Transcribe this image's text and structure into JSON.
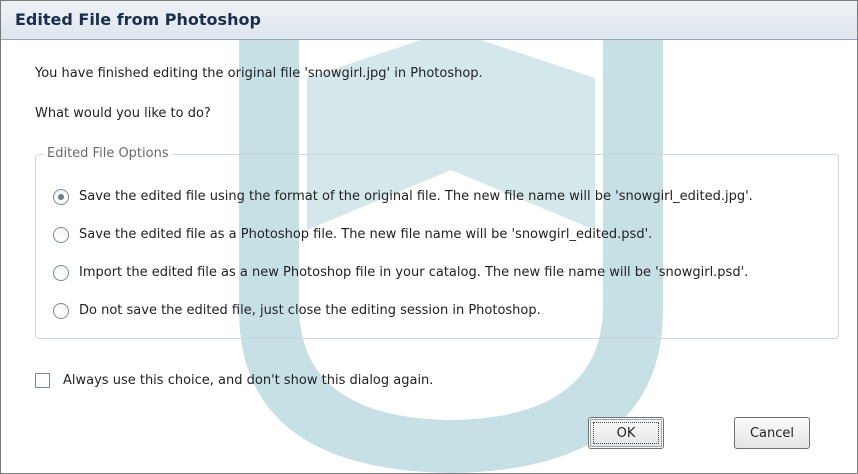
{
  "dialog": {
    "title": "Edited File from Photoshop",
    "message": "You have finished editing the original file 'snowgirl.jpg' in Photoshop.",
    "question": "What would you like to do?",
    "group_title": "Edited File Options",
    "options": [
      {
        "label": "Save the edited file using the format of the original file. The new file name will be 'snowgirl_edited.jpg'.",
        "selected": true
      },
      {
        "label": "Save the edited file as a Photoshop file. The new file name will be 'snowgirl_edited.psd'.",
        "selected": false
      },
      {
        "label": "Import the edited file as a new Photoshop file in your catalog. The new file name will be 'snowgirl.psd'.",
        "selected": false
      },
      {
        "label": "Do not save the edited file, just close the editing session in Photoshop.",
        "selected": false
      }
    ],
    "checkbox_label": "Always use this choice, and don't show this dialog again.",
    "checkbox_checked": false,
    "ok_label": "OK",
    "cancel_label": "Cancel"
  },
  "colors": {
    "title_text": "#1b2e4e",
    "watermark_teal": "#9fc6cf",
    "watermark_pink": "#e7b1c0"
  }
}
